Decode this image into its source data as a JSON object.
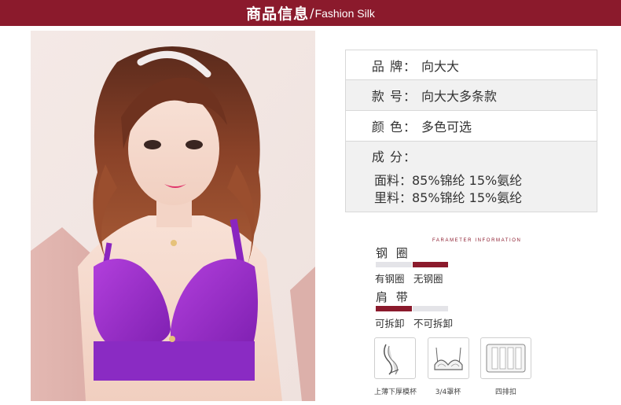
{
  "header": {
    "title_cn": "商品信息",
    "separator": "/",
    "title_en": "Fashion Silk",
    "color": "#8b1a2c"
  },
  "specs": {
    "brand": {
      "label": "品  牌：",
      "value": "向大大"
    },
    "model": {
      "label": "款  号：",
      "value": "向大大多条款"
    },
    "color": {
      "label": "颜  色：",
      "value": "多色可选"
    },
    "composition": {
      "label": "成  分：",
      "outer": "面料：85%锦纶 15%氨纶",
      "lining": "里料：85%锦纶 15%氨纶"
    }
  },
  "parameters": {
    "heading_en": "FARAMETER INFORMATION",
    "underwire": {
      "title": "钢  圈",
      "options": [
        "有钢圈",
        "无钢圈"
      ],
      "selected_index": 1
    },
    "strap": {
      "title": "肩  带",
      "options": [
        "可拆卸",
        "不可拆卸"
      ],
      "selected_index": 0
    }
  },
  "features": [
    {
      "icon": "cup-profile-icon",
      "caption": "上薄下厚模杯"
    },
    {
      "icon": "three-quarter-cup-icon",
      "caption": "3/4罩杯"
    },
    {
      "icon": "four-row-hook-icon",
      "caption": "四排扣"
    }
  ],
  "photo": {
    "subject": "product-photo",
    "product_color": "#9a2bc9"
  }
}
